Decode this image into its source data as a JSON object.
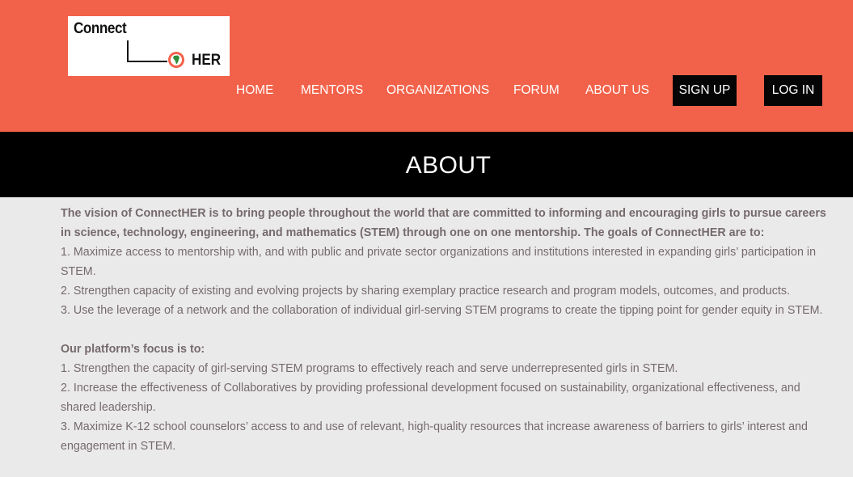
{
  "logo": {
    "word1": "Connect",
    "word2": "HER"
  },
  "nav": {
    "home": "HOME",
    "mentors": "MENTORS",
    "organizations": "ORGANIZATIONS",
    "forum": "FORUM",
    "about": "ABOUT US",
    "signup": "SIGN UP",
    "login": "LOG IN"
  },
  "banner": {
    "title": "ABOUT"
  },
  "about": {
    "intro": "The vision of ConnectHER is to bring people throughout the world that are committed to informing and encouraging girls to pursue careers in science, technology, engineering, and mathematics (STEM) through one on one mentorship. The goals of ConnectHER are to:",
    "goals": [
      "1. Maximize access to mentorship with, and with public and private sector organizations and institutions interested in expanding girls’ participation in STEM.",
      "2. Strengthen capacity of existing and evolving projects by sharing exemplary practice research and program models, outcomes, and products.",
      "3. Use the leverage of a network and the collaboration of individual girl-serving STEM programs to create the tipping point for gender equity in STEM."
    ],
    "focus_heading": "Our platform’s focus is to:",
    "focus": [
      "1. Strengthen the capacity of girl-serving STEM programs to effectively reach and serve underrepresented girls in STEM.",
      "2. Increase the effectiveness of Collaboratives by providing professional development focused on sustainability, organizational effectiveness, and shared leadership.",
      "3. Maximize K-12 school counselors’ access to and use of relevant, high-quality resources that increase awareness of barriers to girls’ interest and engagement in STEM."
    ]
  },
  "colors": {
    "header_bg": "#f2624a",
    "banner_bg": "#000000",
    "body_bg": "#ebeaeb",
    "text": "#756a6c"
  }
}
